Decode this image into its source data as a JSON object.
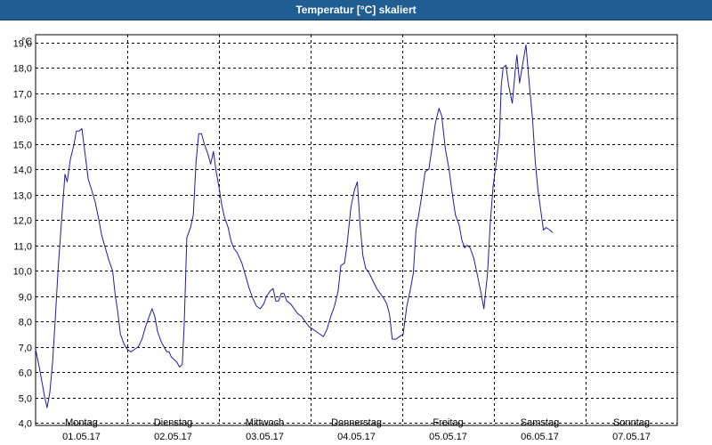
{
  "window": {
    "title": "Temperatur [°C] skaliert"
  },
  "chart_data": {
    "type": "line",
    "title": "Temperatur [°C] skaliert",
    "unit": "°C",
    "ylim": [
      3.9,
      19.3
    ],
    "yticks": [
      4.0,
      5.0,
      6.0,
      7.0,
      8.0,
      9.0,
      10.0,
      11.0,
      12.0,
      13.0,
      14.0,
      15.0,
      16.0,
      17.0,
      18.0,
      19.0
    ],
    "ytick_labels": [
      "4,0",
      "5,0",
      "6,0",
      "7,0",
      "8,0",
      "9,0",
      "10,0",
      "11,0",
      "12,0",
      "13,0",
      "14,0",
      "15,0",
      "16,0",
      "17,0",
      "18,0",
      "19,0"
    ],
    "xlim": [
      0,
      7
    ],
    "x_unit": "days since 01.05.17 00:00",
    "days": [
      {
        "weekday": "Montag",
        "date": "01.05.17"
      },
      {
        "weekday": "Dienstag",
        "date": "02.05.17"
      },
      {
        "weekday": "Mittwoch",
        "date": "03.05.17"
      },
      {
        "weekday": "Donnerstag",
        "date": "04.05.17"
      },
      {
        "weekday": "Freitag",
        "date": "05.05.17"
      },
      {
        "weekday": "Samstag",
        "date": "06.05.17"
      },
      {
        "weekday": "Sonntag",
        "date": "07.05.17"
      }
    ],
    "grid": true,
    "line_color": "#1c1ca8",
    "series": [
      {
        "name": "Temperatur",
        "points": [
          [
            0.0,
            6.9
          ],
          [
            0.04,
            6.2
          ],
          [
            0.07,
            5.6
          ],
          [
            0.1,
            5.0
          ],
          [
            0.125,
            4.6
          ],
          [
            0.155,
            5.2
          ],
          [
            0.185,
            6.4
          ],
          [
            0.215,
            8.1
          ],
          [
            0.245,
            10.0
          ],
          [
            0.28,
            11.8
          ],
          [
            0.32,
            13.8
          ],
          [
            0.345,
            13.5
          ],
          [
            0.38,
            14.4
          ],
          [
            0.42,
            15.0
          ],
          [
            0.445,
            15.5
          ],
          [
            0.475,
            15.5
          ],
          [
            0.505,
            15.6
          ],
          [
            0.54,
            14.6
          ],
          [
            0.575,
            13.6
          ],
          [
            0.61,
            13.2
          ],
          [
            0.65,
            12.7
          ],
          [
            0.69,
            12.0
          ],
          [
            0.72,
            11.4
          ],
          [
            0.76,
            10.9
          ],
          [
            0.8,
            10.4
          ],
          [
            0.84,
            10.0
          ],
          [
            0.87,
            9.0
          ],
          [
            0.895,
            8.4
          ],
          [
            0.925,
            7.5
          ],
          [
            0.965,
            7.1
          ],
          [
            1.0,
            6.9
          ],
          [
            1.04,
            6.8
          ],
          [
            1.08,
            6.9
          ],
          [
            1.12,
            7.0
          ],
          [
            1.16,
            7.3
          ],
          [
            1.2,
            7.8
          ],
          [
            1.24,
            8.2
          ],
          [
            1.27,
            8.5
          ],
          [
            1.3,
            8.2
          ],
          [
            1.33,
            7.6
          ],
          [
            1.37,
            7.2
          ],
          [
            1.4,
            7.0
          ],
          [
            1.43,
            6.8
          ],
          [
            1.455,
            6.8
          ],
          [
            1.48,
            6.6
          ],
          [
            1.51,
            6.5
          ],
          [
            1.54,
            6.4
          ],
          [
            1.57,
            6.2
          ],
          [
            1.6,
            6.3
          ],
          [
            1.62,
            7.8
          ],
          [
            1.65,
            11.3
          ],
          [
            1.69,
            11.7
          ],
          [
            1.72,
            12.2
          ],
          [
            1.75,
            14.3
          ],
          [
            1.78,
            15.4
          ],
          [
            1.81,
            15.4
          ],
          [
            1.84,
            15.0
          ],
          [
            1.88,
            14.6
          ],
          [
            1.91,
            14.2
          ],
          [
            1.94,
            14.7
          ],
          [
            1.97,
            13.9
          ],
          [
            2.0,
            13.3
          ],
          [
            2.03,
            12.6
          ],
          [
            2.06,
            12.1
          ],
          [
            2.1,
            11.7
          ],
          [
            2.13,
            11.2
          ],
          [
            2.16,
            10.9
          ],
          [
            2.2,
            10.7
          ],
          [
            2.25,
            10.3
          ],
          [
            2.29,
            9.8
          ],
          [
            2.33,
            9.3
          ],
          [
            2.37,
            8.9
          ],
          [
            2.41,
            8.6
          ],
          [
            2.45,
            8.5
          ],
          [
            2.49,
            8.7
          ],
          [
            2.52,
            9.0
          ],
          [
            2.56,
            9.2
          ],
          [
            2.59,
            9.3
          ],
          [
            2.62,
            8.8
          ],
          [
            2.65,
            8.8
          ],
          [
            2.68,
            9.1
          ],
          [
            2.71,
            9.1
          ],
          [
            2.74,
            8.8
          ],
          [
            2.78,
            8.7
          ],
          [
            2.82,
            8.5
          ],
          [
            2.86,
            8.3
          ],
          [
            2.9,
            8.2
          ],
          [
            2.94,
            8.0
          ],
          [
            2.98,
            7.8
          ],
          [
            3.02,
            7.7
          ],
          [
            3.06,
            7.6
          ],
          [
            3.1,
            7.5
          ],
          [
            3.14,
            7.4
          ],
          [
            3.18,
            7.7
          ],
          [
            3.22,
            8.2
          ],
          [
            3.26,
            8.6
          ],
          [
            3.3,
            9.2
          ],
          [
            3.33,
            10.2
          ],
          [
            3.37,
            10.3
          ],
          [
            3.4,
            11.1
          ],
          [
            3.44,
            12.5
          ],
          [
            3.48,
            13.2
          ],
          [
            3.51,
            13.5
          ],
          [
            3.54,
            11.8
          ],
          [
            3.57,
            10.6
          ],
          [
            3.6,
            10.1
          ],
          [
            3.64,
            9.9
          ],
          [
            3.68,
            9.6
          ],
          [
            3.72,
            9.3
          ],
          [
            3.76,
            9.1
          ],
          [
            3.8,
            8.9
          ],
          [
            3.83,
            8.7
          ],
          [
            3.86,
            8.3
          ],
          [
            3.89,
            7.3
          ],
          [
            3.93,
            7.3
          ],
          [
            3.97,
            7.4
          ],
          [
            4.01,
            7.5
          ],
          [
            4.05,
            8.6
          ],
          [
            4.09,
            9.3
          ],
          [
            4.12,
            9.9
          ],
          [
            4.15,
            11.6
          ],
          [
            4.18,
            12.2
          ],
          [
            4.21,
            12.9
          ],
          [
            4.25,
            13.9
          ],
          [
            4.29,
            14.0
          ],
          [
            4.33,
            15.0
          ],
          [
            4.36,
            15.8
          ],
          [
            4.4,
            16.4
          ],
          [
            4.43,
            16.1
          ],
          [
            4.47,
            14.8
          ],
          [
            4.51,
            14.0
          ],
          [
            4.55,
            12.9
          ],
          [
            4.58,
            12.2
          ],
          [
            4.62,
            11.8
          ],
          [
            4.65,
            11.2
          ],
          [
            4.68,
            10.9
          ],
          [
            4.71,
            11.0
          ],
          [
            4.74,
            10.9
          ],
          [
            4.78,
            10.5
          ],
          [
            4.82,
            9.8
          ],
          [
            4.86,
            9.1
          ],
          [
            4.89,
            8.5
          ],
          [
            4.93,
            9.9
          ],
          [
            4.96,
            11.9
          ],
          [
            4.99,
            13.3
          ],
          [
            5.03,
            14.4
          ],
          [
            5.06,
            15.3
          ],
          [
            5.08,
            17.3
          ],
          [
            5.1,
            18.0
          ],
          [
            5.13,
            18.1
          ],
          [
            5.16,
            17.3
          ],
          [
            5.2,
            16.6
          ],
          [
            5.23,
            17.8
          ],
          [
            5.25,
            18.5
          ],
          [
            5.28,
            17.4
          ],
          [
            5.32,
            18.3
          ],
          [
            5.35,
            18.9
          ],
          [
            5.38,
            17.6
          ],
          [
            5.42,
            16.0
          ],
          [
            5.45,
            14.3
          ],
          [
            5.48,
            13.2
          ],
          [
            5.51,
            12.4
          ],
          [
            5.54,
            11.6
          ],
          [
            5.57,
            11.7
          ],
          [
            5.61,
            11.6
          ],
          [
            5.64,
            11.5
          ]
        ]
      }
    ]
  }
}
